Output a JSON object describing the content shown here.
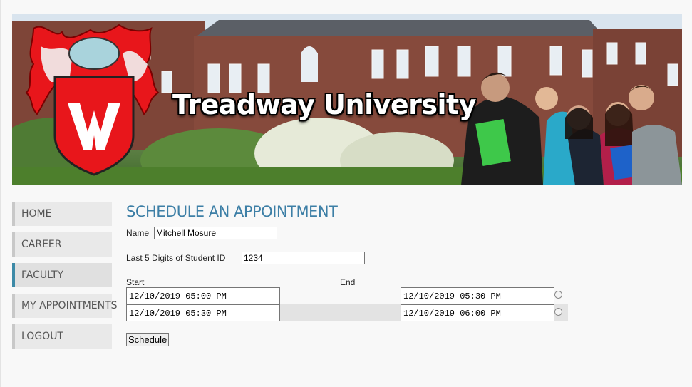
{
  "header": {
    "title": "Treadway University",
    "logo_icon": "university-crest-icon",
    "brand_red": "#e8161b"
  },
  "nav": {
    "items": [
      {
        "label": "HOME"
      },
      {
        "label": "CAREER"
      },
      {
        "label": "FACULTY",
        "active": true
      },
      {
        "label": "MY APPOINTMENTS"
      },
      {
        "label": "LOGOUT"
      }
    ],
    "accent_color": "#3d8aa7"
  },
  "form": {
    "title": "SCHEDULE AN APPOINTMENT",
    "name_label": "Name",
    "name_value": "Mitchell Mosure",
    "student_id_label": "Last 5 Digits of Student ID",
    "student_id_value": "1234",
    "start_label": "Start",
    "end_label": "End",
    "slots": [
      {
        "start": "12/10/2019 05:00 PM",
        "end": "12/10/2019 05:30 PM",
        "selected": false
      },
      {
        "start": "12/10/2019 05:30 PM",
        "end": "12/10/2019 06:00 PM",
        "selected": false
      }
    ],
    "submit_label": "Schedule"
  }
}
